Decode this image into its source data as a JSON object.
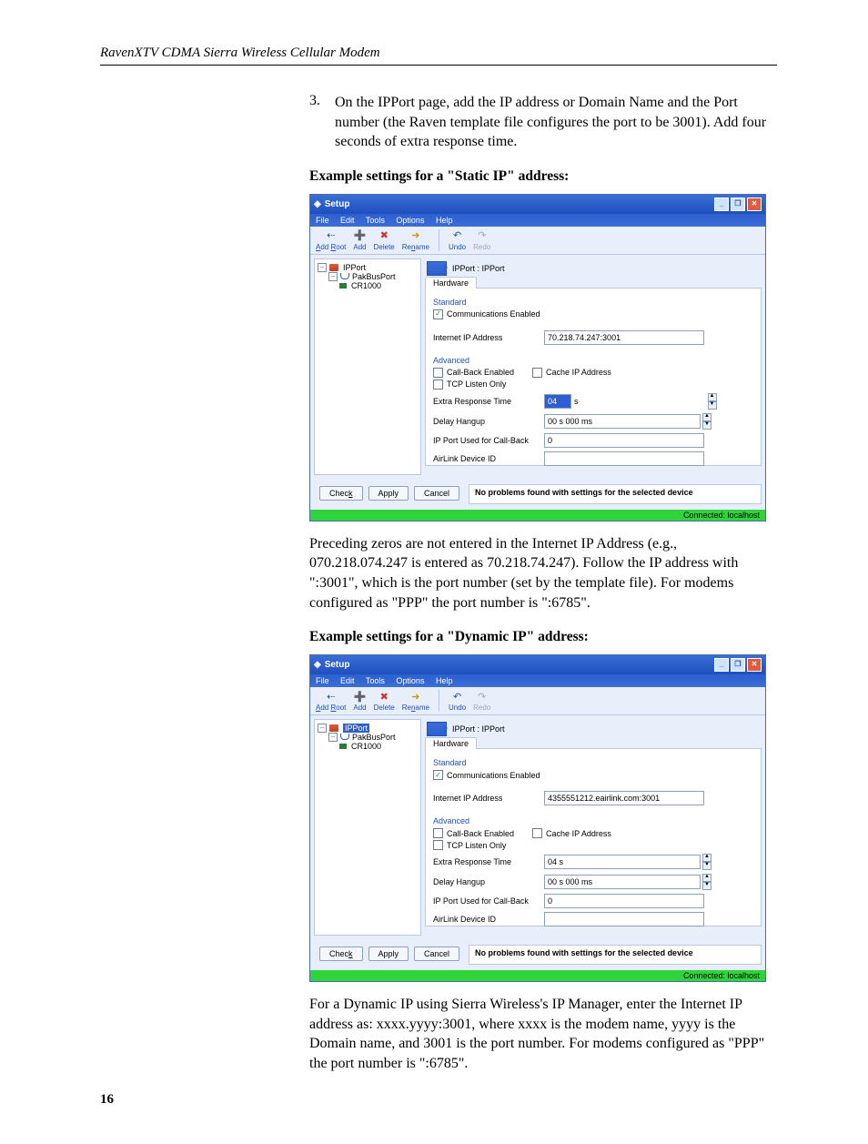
{
  "header": {
    "title": "RavenXTV CDMA Sierra Wireless Cellular Modem"
  },
  "item3": {
    "num": "3.",
    "text": "On the IPPort page, add the IP address or Domain Name and the Port number (the Raven template file configures the port to be 3001).  Add four seconds of extra response time."
  },
  "static_heading": "Example settings for a \"Static IP\" address:",
  "dynamic_heading": "Example settings for a \"Dynamic IP\" address:",
  "para1": "Preceding zeros are not entered in the Internet IP Address (e.g., 070.218.074.247 is entered as 70.218.74.247).  Follow the IP address with \":3001\", which is the port number (set by the template file).  For modems configured as \"PPP\" the port number is \":6785\".",
  "para2": "For a Dynamic IP using Sierra Wireless's IP Manager, enter the Internet IP address as: xxxx.yyyy:3001, where xxxx is the modem name, yyyy is the Domain name, and 3001 is the port number.  For modems configured as \"PPP\" the port number is \":6785\".",
  "pagenum": "16",
  "win": {
    "title": "Setup",
    "menus": [
      "File",
      "Edit",
      "Tools",
      "Options",
      "Help"
    ],
    "toolbar": {
      "addroot": "Add Root",
      "add": "Add",
      "delete": "Delete",
      "rename": "Rename",
      "undo": "Undo",
      "redo": "Redo"
    },
    "tree": {
      "root": "IPPort",
      "child1": "PakBusPort",
      "child2": "CR1000"
    },
    "tabline": "IPPort : IPPort",
    "tab": "Hardware",
    "form": {
      "section_std": "Standard",
      "comm_enabled": "Communications Enabled",
      "ip_label": "Internet IP Address",
      "section_adv": "Advanced",
      "callback": "Call-Back Enabled",
      "cache": "Cache IP Address",
      "tcp": "TCP Listen Only",
      "extra_resp": "Extra Response Time",
      "extra_resp_val_hl": "04",
      "extra_resp_val": "04 s",
      "extra_resp_unit": "s",
      "delay": "Delay Hangup",
      "delay_val": "00 s 000 ms",
      "ipport_cb": "IP Port Used for Call-Back",
      "ipport_cb_val": "0",
      "airlink": "AirLink Device ID"
    },
    "msg": "No problems found with settings for the selected device",
    "buttons": {
      "check": "Check",
      "apply": "Apply",
      "cancel": "Cancel"
    },
    "status": "Connected: localhost"
  },
  "static_ip": "70.218.74.247:3001",
  "dynamic_ip": "4355551212.eairlink.com:3001"
}
